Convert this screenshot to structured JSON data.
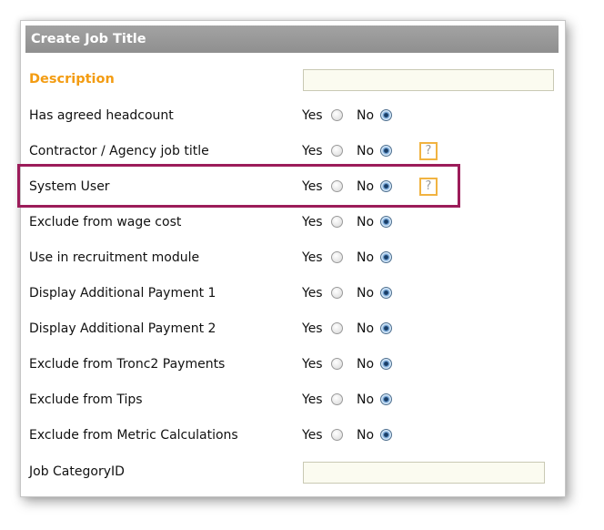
{
  "form": {
    "title": "Create Job Title",
    "description_label": "Description",
    "description_value": "",
    "yes_label": "Yes",
    "no_label": "No",
    "help_glyph": "?",
    "rows": [
      {
        "label": "Has agreed headcount",
        "selected": "No",
        "help": false
      },
      {
        "label": "Contractor / Agency job title",
        "selected": "No",
        "help": true
      },
      {
        "label": "System User",
        "selected": "No",
        "help": true
      },
      {
        "label": "Exclude from wage cost",
        "selected": "No",
        "help": false
      },
      {
        "label": "Use in recruitment module",
        "selected": "No",
        "help": false
      },
      {
        "label": "Display Additional Payment 1",
        "selected": "No",
        "help": false
      },
      {
        "label": "Display Additional Payment 2",
        "selected": "No",
        "help": false
      },
      {
        "label": "Exclude from Tronc2 Payments",
        "selected": "No",
        "help": false
      },
      {
        "label": "Exclude from Tips",
        "selected": "No",
        "help": false
      },
      {
        "label": "Exclude from Metric Calculations",
        "selected": "No",
        "help": false
      }
    ],
    "job_category_label": "Job CategoryID",
    "job_category_value": ""
  },
  "highlighted_row": "System User",
  "colors": {
    "header_bg": "#999999",
    "accent": "#f39c12",
    "highlight_border": "#9c1c5a",
    "help_border": "#f1b341"
  },
  "icons": {
    "help": "question-mark-icon",
    "radio": "radio-button"
  }
}
